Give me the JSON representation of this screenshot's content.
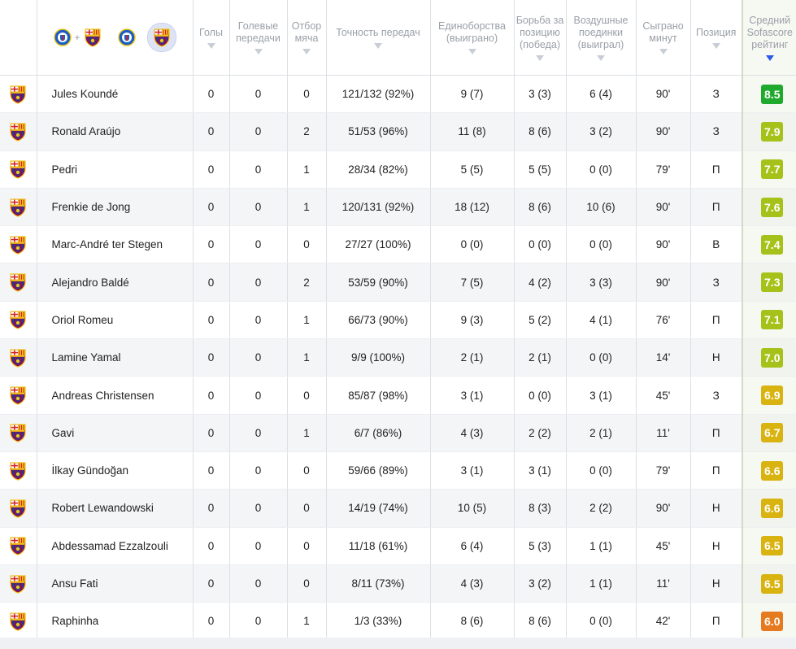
{
  "header": {
    "columns": [
      {
        "key": "goals",
        "label": "Голы"
      },
      {
        "key": "assists",
        "label": "Голевые передачи"
      },
      {
        "key": "tackles",
        "label": "Отбор мяча"
      },
      {
        "key": "passes",
        "label": "Точность передач"
      },
      {
        "key": "duels",
        "label": "Единоборства (выиграно)"
      },
      {
        "key": "ground",
        "label": "Борьба за позицию (победа)"
      },
      {
        "key": "aerial",
        "label": "Воздушные поединки (выиграл)"
      },
      {
        "key": "minutes",
        "label": "Сыграно минут"
      },
      {
        "key": "position",
        "label": "Позиция"
      },
      {
        "key": "rating",
        "label": "Средний Sofascore рейтинг"
      }
    ],
    "team_filter": {
      "both_plus": "+",
      "options": [
        "getafe-and-barcelona",
        "getafe",
        "barcelona"
      ],
      "selected": "barcelona"
    }
  },
  "colors": {
    "rating_high": "#1faa2e",
    "rating_good": "#a6c21a",
    "rating_mid": "#d9b310",
    "rating_low": "#e57a1f",
    "sort_active": "#2b59e8"
  },
  "players": [
    {
      "name": "Jules Koundé",
      "goals": "0",
      "assists": "0",
      "tackles": "0",
      "passes": "121/132 (92%)",
      "duels": "9 (7)",
      "ground": "3 (3)",
      "aerial": "6 (4)",
      "minutes": "90'",
      "position": "З",
      "rating": "8.5",
      "rating_color": "#1faa2e"
    },
    {
      "name": "Ronald Araújo",
      "goals": "0",
      "assists": "0",
      "tackles": "2",
      "passes": "51/53 (96%)",
      "duels": "11 (8)",
      "ground": "8 (6)",
      "aerial": "3 (2)",
      "minutes": "90'",
      "position": "З",
      "rating": "7.9",
      "rating_color": "#a6c21a"
    },
    {
      "name": "Pedri",
      "goals": "0",
      "assists": "0",
      "tackles": "1",
      "passes": "28/34 (82%)",
      "duels": "5 (5)",
      "ground": "5 (5)",
      "aerial": "0 (0)",
      "minutes": "79'",
      "position": "П",
      "rating": "7.7",
      "rating_color": "#a6c21a"
    },
    {
      "name": "Frenkie de Jong",
      "goals": "0",
      "assists": "0",
      "tackles": "1",
      "passes": "120/131 (92%)",
      "duels": "18 (12)",
      "ground": "8 (6)",
      "aerial": "10 (6)",
      "minutes": "90'",
      "position": "П",
      "rating": "7.6",
      "rating_color": "#a6c21a"
    },
    {
      "name": "Marc-André ter Stegen",
      "goals": "0",
      "assists": "0",
      "tackles": "0",
      "passes": "27/27 (100%)",
      "duels": "0 (0)",
      "ground": "0 (0)",
      "aerial": "0 (0)",
      "minutes": "90'",
      "position": "В",
      "rating": "7.4",
      "rating_color": "#a6c21a"
    },
    {
      "name": "Alejandro Baldé",
      "goals": "0",
      "assists": "0",
      "tackles": "2",
      "passes": "53/59 (90%)",
      "duels": "7 (5)",
      "ground": "4 (2)",
      "aerial": "3 (3)",
      "minutes": "90'",
      "position": "З",
      "rating": "7.3",
      "rating_color": "#a6c21a"
    },
    {
      "name": "Oriol Romeu",
      "goals": "0",
      "assists": "0",
      "tackles": "1",
      "passes": "66/73 (90%)",
      "duels": "9 (3)",
      "ground": "5 (2)",
      "aerial": "4 (1)",
      "minutes": "76'",
      "position": "П",
      "rating": "7.1",
      "rating_color": "#a6c21a"
    },
    {
      "name": "Lamine Yamal",
      "goals": "0",
      "assists": "0",
      "tackles": "1",
      "passes": "9/9 (100%)",
      "duels": "2 (1)",
      "ground": "2 (1)",
      "aerial": "0 (0)",
      "minutes": "14'",
      "position": "Н",
      "rating": "7.0",
      "rating_color": "#a6c21a"
    },
    {
      "name": "Andreas Christensen",
      "goals": "0",
      "assists": "0",
      "tackles": "0",
      "passes": "85/87 (98%)",
      "duels": "3 (1)",
      "ground": "0 (0)",
      "aerial": "3 (1)",
      "minutes": "45'",
      "position": "З",
      "rating": "6.9",
      "rating_color": "#d9b310"
    },
    {
      "name": "Gavi",
      "goals": "0",
      "assists": "0",
      "tackles": "1",
      "passes": "6/7 (86%)",
      "duels": "4 (3)",
      "ground": "2 (2)",
      "aerial": "2 (1)",
      "minutes": "11'",
      "position": "П",
      "rating": "6.7",
      "rating_color": "#d9b310"
    },
    {
      "name": "İlkay Gündoğan",
      "goals": "0",
      "assists": "0",
      "tackles": "0",
      "passes": "59/66 (89%)",
      "duels": "3 (1)",
      "ground": "3 (1)",
      "aerial": "0 (0)",
      "minutes": "79'",
      "position": "П",
      "rating": "6.6",
      "rating_color": "#d9b310"
    },
    {
      "name": "Robert Lewandowski",
      "goals": "0",
      "assists": "0",
      "tackles": "0",
      "passes": "14/19 (74%)",
      "duels": "10 (5)",
      "ground": "8 (3)",
      "aerial": "2 (2)",
      "minutes": "90'",
      "position": "Н",
      "rating": "6.6",
      "rating_color": "#d9b310"
    },
    {
      "name": "Abdessamad Ezzalzouli",
      "goals": "0",
      "assists": "0",
      "tackles": "0",
      "passes": "11/18 (61%)",
      "duels": "6 (4)",
      "ground": "5 (3)",
      "aerial": "1 (1)",
      "minutes": "45'",
      "position": "Н",
      "rating": "6.5",
      "rating_color": "#d9b310"
    },
    {
      "name": "Ansu Fati",
      "goals": "0",
      "assists": "0",
      "tackles": "0",
      "passes": "8/11 (73%)",
      "duels": "4 (3)",
      "ground": "3 (2)",
      "aerial": "1 (1)",
      "minutes": "11'",
      "position": "Н",
      "rating": "6.5",
      "rating_color": "#d9b310"
    },
    {
      "name": "Raphinha",
      "goals": "0",
      "assists": "0",
      "tackles": "1",
      "passes": "1/3 (33%)",
      "duels": "8 (6)",
      "ground": "8 (6)",
      "aerial": "0 (0)",
      "minutes": "42'",
      "position": "П",
      "rating": "6.0",
      "rating_color": "#e57a1f"
    }
  ]
}
